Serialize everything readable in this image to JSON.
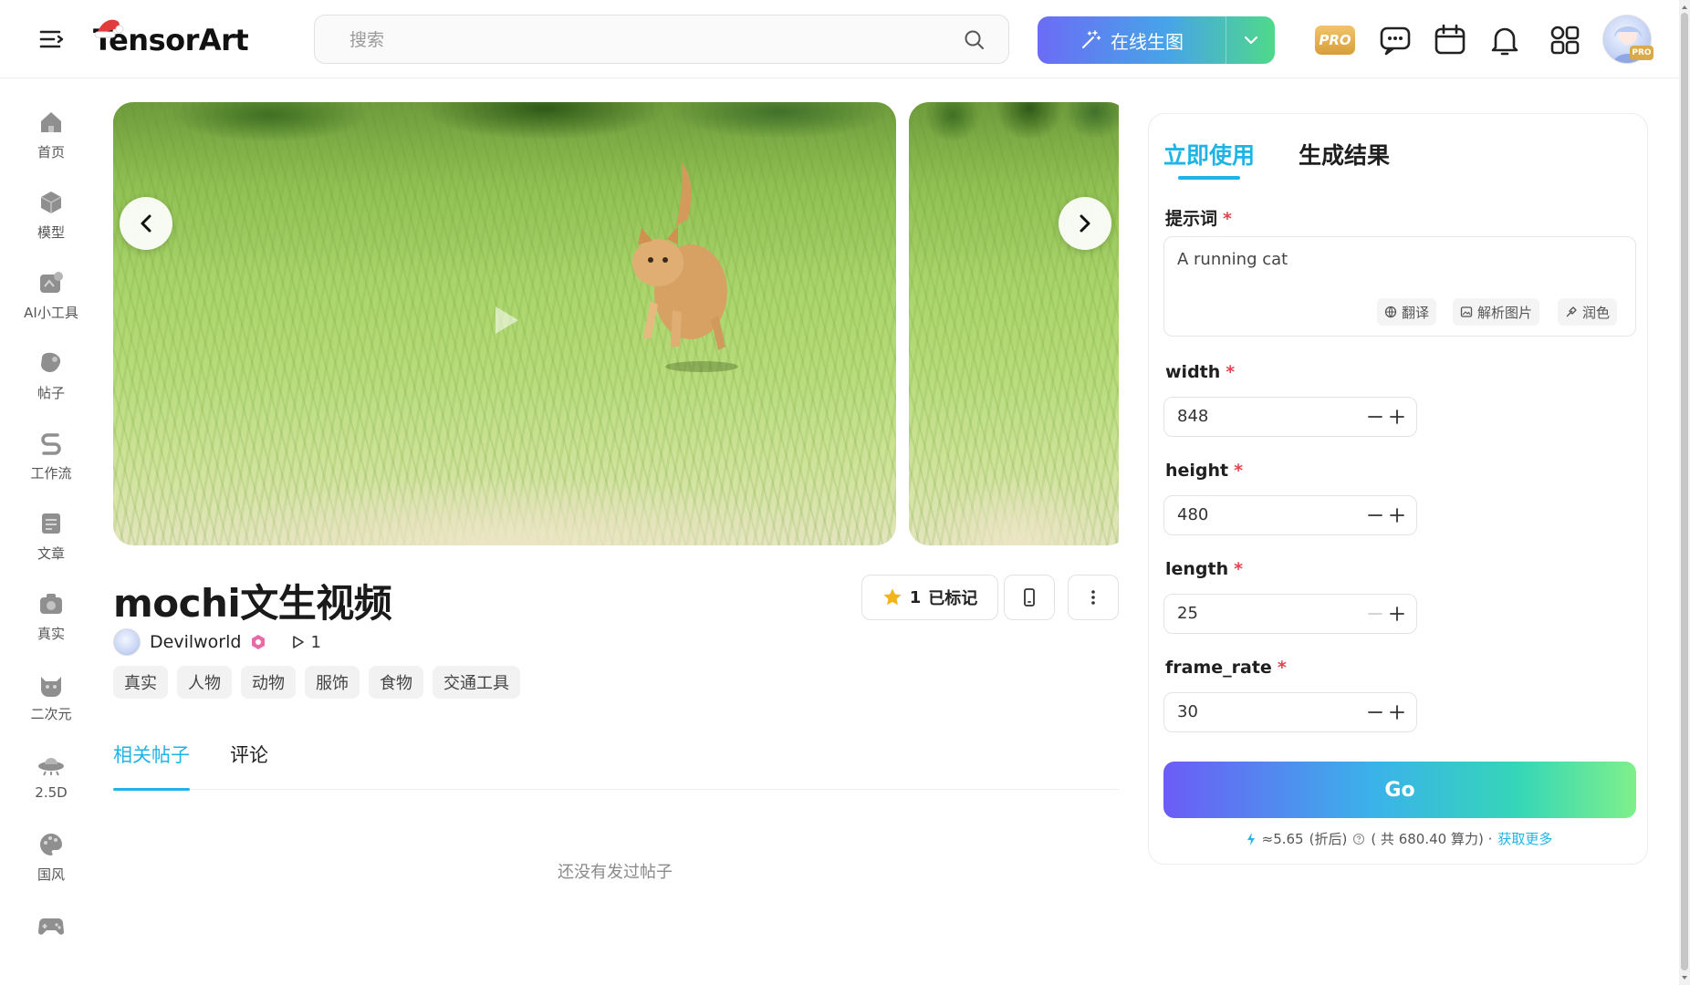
{
  "header": {
    "logo_text": "TensorArt",
    "search_placeholder": "搜索",
    "generate_label": "在线生图",
    "pro_label": "PRO",
    "avatar_pro_label": "PRO"
  },
  "sidebar": {
    "items": [
      {
        "label": "首页",
        "icon": "home-icon"
      },
      {
        "label": "模型",
        "icon": "cube-icon"
      },
      {
        "label": "AI小工具",
        "icon": "tools-icon"
      },
      {
        "label": "帖子",
        "icon": "post-icon"
      },
      {
        "label": "工作流",
        "icon": "workflow-icon"
      },
      {
        "label": "文章",
        "icon": "article-icon"
      },
      {
        "label": "真实",
        "icon": "camera-icon"
      },
      {
        "label": "二次元",
        "icon": "anime-cat-icon"
      },
      {
        "label": "2.5D",
        "icon": "ufo-icon"
      },
      {
        "label": "国风",
        "icon": "palette-icon"
      },
      {
        "label": "",
        "icon": "gamepad-icon"
      }
    ]
  },
  "main": {
    "title": "mochi文生视频",
    "favorite_count": "1",
    "favorite_label": "已标记",
    "author": "Devilworld",
    "run_count": "1",
    "tags": [
      "真实",
      "人物",
      "动物",
      "服饰",
      "食物",
      "交通工具"
    ],
    "tabs": [
      {
        "label": "相关帖子",
        "active": true
      },
      {
        "label": "评论",
        "active": false
      }
    ],
    "empty_text": "还没有发过帖子"
  },
  "panel": {
    "tabs": [
      {
        "label": "立即使用",
        "active": true
      },
      {
        "label": "生成结果",
        "active": false
      }
    ],
    "prompt": {
      "label": "提示词",
      "required": "*",
      "value": "A running cat",
      "actions": [
        "翻译",
        "解析图片",
        "润色"
      ]
    },
    "fields": [
      {
        "label": "width",
        "value": "848"
      },
      {
        "label": "height",
        "value": "480"
      },
      {
        "label": "length",
        "value": "25"
      },
      {
        "label": "frame_rate",
        "value": "30"
      }
    ],
    "go_label": "Go",
    "cost": {
      "amount": "≈5.65",
      "discount": "(折后)",
      "total": "( 共 680.40 算力) ·",
      "more_link": "获取更多"
    }
  },
  "colors": {
    "accent": "#1fb4e6",
    "required": "#e2454f",
    "pro_gold": "#d9a94a"
  }
}
